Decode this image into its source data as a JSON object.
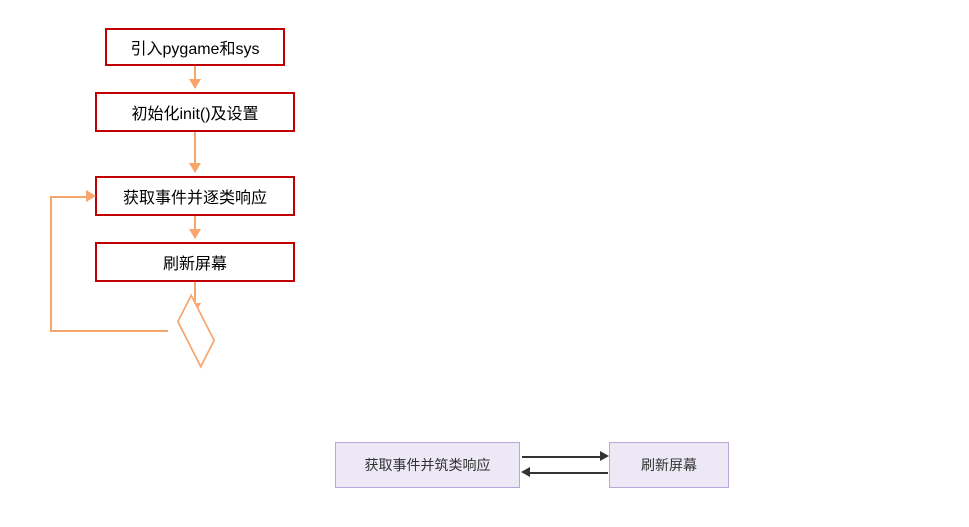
{
  "chart_data": {
    "type": "flowchart",
    "nodes": [
      {
        "id": "n1",
        "label": "引入pygame和sys",
        "shape": "process"
      },
      {
        "id": "n2",
        "label": "初始化init()及设置",
        "shape": "process"
      },
      {
        "id": "n3",
        "label": "获取事件并逐类响应",
        "shape": "process"
      },
      {
        "id": "n4",
        "label": "刷新屏幕",
        "shape": "process"
      },
      {
        "id": "d1",
        "label": "",
        "shape": "decision"
      }
    ],
    "edges": [
      {
        "from": "n1",
        "to": "n2"
      },
      {
        "from": "n2",
        "to": "n3"
      },
      {
        "from": "n3",
        "to": "n4"
      },
      {
        "from": "n4",
        "to": "d1"
      },
      {
        "from": "d1",
        "to": "n3",
        "loop": true
      }
    ]
  },
  "aux_diagram": {
    "left": "获取事件并筑类响应",
    "right": "刷新屏幕",
    "relation": "bidirectional"
  }
}
